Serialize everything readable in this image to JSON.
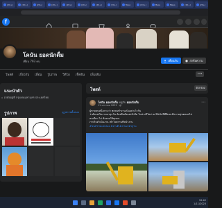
{
  "browser": {
    "tabs": [
      {
        "label": "(20+)"
      },
      {
        "label": "(20+)"
      },
      {
        "label": "(20+)"
      },
      {
        "label": "(20+)"
      },
      {
        "label": "(20+)"
      },
      {
        "label": "(20+)"
      },
      {
        "label": "(20+)"
      },
      {
        "label": "(20+)"
      },
      {
        "label": "Mess"
      },
      {
        "label": "(20+)"
      },
      {
        "label": "Mess"
      },
      {
        "label": "Mess"
      },
      {
        "label": "(20+)"
      },
      {
        "label": "(20+)"
      }
    ]
  },
  "profile": {
    "name": "โคนัน ยอดนักดื่ม",
    "followers": "เพื่อน 793 คน",
    "add_friend_label": "เพื่อนกัน",
    "message_label": "ส่งข้อความ"
  },
  "profile_tabs": {
    "items": [
      "โพสต์",
      "เกี่ยวกับ",
      "เพื่อน",
      "รูปภาพ",
      "วิดีโอ",
      "เช็คอิน",
      "เพิ่มเติม"
    ],
    "more_label": "•••"
  },
  "intro": {
    "title": "แนะนำตัว",
    "line": "อาศัยอยู่ที่ กรุงเทพมหานคร ประเทศไทย"
  },
  "photos": {
    "title": "รูปภาพ",
    "see_all": "ดูรูปภาพทั้งหมด"
  },
  "posts": {
    "title": "โพสต์",
    "filter_label": "ตัวกรอง"
  },
  "post": {
    "author": "โคนัน ยอดนักดื่ม",
    "action": " อยู่กับ ",
    "with": "ยอดนักดื่ม",
    "date": "11 มกราคม 2022 · ",
    "lines": [
      "ผู้ชายคนหนึ่งถามว่า ทุกคนทำงานเป็นอย่างไรกัน",
      "ว่าตั้งแต่เริ่มงานมาทุกวัน ต้องตื่นตั้งแต่เช้ามืด ในช่วงปีใหม่ ขอให้เป็นปีที่ดีและมีความสุขตลอดไป",
      "คนเดียว ไม่ ต้องขอให้ทุกคน",
      "เราเริ่มดำเนินงาน เข้าใจสถานที่หน้างาน"
    ],
    "tags": "#ขนทรายแม่กลอง #งานดี #งานมาตรฐาน"
  },
  "taskbar": {
    "time": "12:42",
    "date": "1/11/2023"
  },
  "colors": {
    "accent": "#1877f2",
    "link": "#2d88ff",
    "background": "#18191a",
    "card": "#242526"
  }
}
